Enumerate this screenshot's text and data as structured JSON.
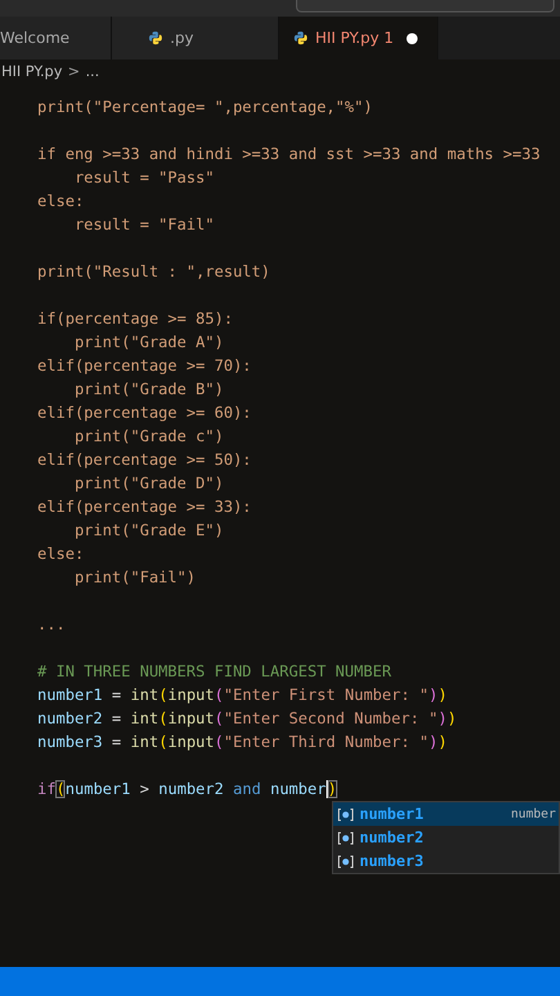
{
  "tabs": [
    {
      "label": "Welcome",
      "kind": "plain",
      "selected": false,
      "has_problems": false,
      "modified": false
    },
    {
      "label": ".py",
      "kind": "python",
      "selected": false,
      "has_problems": false,
      "modified": false
    },
    {
      "label": "HII PY.py 1",
      "kind": "python",
      "selected": true,
      "has_problems": true,
      "modified": true
    }
  ],
  "breadcrumb": {
    "file": "HII PY.py",
    "separator": ">",
    "tail": "..."
  },
  "editor": {
    "lines": [
      {
        "tokens": [
          {
            "text": "print(\"Percentage= \",percentage,\"%\")",
            "kind": "plain"
          }
        ]
      },
      {
        "kind": "blank"
      },
      {
        "tokens": [
          {
            "text": "if eng >=33 and hindi >=33 and sst >=33 and maths >=33",
            "kind": "plain"
          }
        ]
      },
      {
        "tokens": [
          {
            "text": "    result = \"Pass\"",
            "kind": "plain"
          }
        ]
      },
      {
        "tokens": [
          {
            "text": "else:",
            "kind": "plain"
          }
        ]
      },
      {
        "tokens": [
          {
            "text": "    result = \"Fail\"",
            "kind": "plain"
          }
        ]
      },
      {
        "kind": "blank"
      },
      {
        "tokens": [
          {
            "text": "print(\"Result : \",result)",
            "kind": "plain"
          }
        ]
      },
      {
        "kind": "blank"
      },
      {
        "tokens": [
          {
            "text": "if(percentage >= 85):",
            "kind": "plain"
          }
        ]
      },
      {
        "tokens": [
          {
            "text": "    print(\"Grade A\")",
            "kind": "plain"
          }
        ]
      },
      {
        "tokens": [
          {
            "text": "elif(percentage >= 70):",
            "kind": "plain"
          }
        ]
      },
      {
        "tokens": [
          {
            "text": "    print(\"Grade B\")",
            "kind": "plain"
          }
        ]
      },
      {
        "tokens": [
          {
            "text": "elif(percentage >= 60):",
            "kind": "plain"
          }
        ]
      },
      {
        "tokens": [
          {
            "text": "    print(\"Grade c\")",
            "kind": "plain"
          }
        ]
      },
      {
        "tokens": [
          {
            "text": "elif(percentage >= 50):",
            "kind": "plain"
          }
        ]
      },
      {
        "tokens": [
          {
            "text": "    print(\"Grade D\")",
            "kind": "plain"
          }
        ]
      },
      {
        "tokens": [
          {
            "text": "elif(percentage >= 33):",
            "kind": "plain"
          }
        ]
      },
      {
        "tokens": [
          {
            "text": "    print(\"Grade E\")",
            "kind": "plain"
          }
        ]
      },
      {
        "tokens": [
          {
            "text": "else:",
            "kind": "plain"
          }
        ]
      },
      {
        "tokens": [
          {
            "text": "    print(\"Fail\")",
            "kind": "plain"
          }
        ]
      },
      {
        "kind": "blank"
      },
      {
        "tokens": [
          {
            "text": "...",
            "kind": "plain"
          }
        ]
      },
      {
        "kind": "blank"
      },
      {
        "tokens": [
          {
            "text": "# IN THREE NUMBERS FIND LARGEST NUMBER",
            "kind": "comment"
          }
        ]
      },
      {
        "tokens": [
          {
            "text": "number1",
            "kind": "variable"
          },
          {
            "text": " = ",
            "kind": "operator"
          },
          {
            "text": "int",
            "kind": "function"
          },
          {
            "text": "(",
            "kind": "bracket"
          },
          {
            "text": "input",
            "kind": "function"
          },
          {
            "text": "(",
            "kind": "bracket2"
          },
          {
            "text": "\"Enter First Number: \"",
            "kind": "string"
          },
          {
            "text": ")",
            "kind": "bracket2"
          },
          {
            "text": ")",
            "kind": "bracket"
          }
        ]
      },
      {
        "tokens": [
          {
            "text": "number2",
            "kind": "variable"
          },
          {
            "text": " = ",
            "kind": "operator"
          },
          {
            "text": "int",
            "kind": "function"
          },
          {
            "text": "(",
            "kind": "bracket"
          },
          {
            "text": "input",
            "kind": "function"
          },
          {
            "text": "(",
            "kind": "bracket2"
          },
          {
            "text": "\"Enter Second Number: \"",
            "kind": "string"
          },
          {
            "text": ")",
            "kind": "bracket2"
          },
          {
            "text": ")",
            "kind": "bracket"
          }
        ]
      },
      {
        "tokens": [
          {
            "text": "number3",
            "kind": "variable"
          },
          {
            "text": " = ",
            "kind": "operator"
          },
          {
            "text": "int",
            "kind": "function"
          },
          {
            "text": "(",
            "kind": "bracket"
          },
          {
            "text": "input",
            "kind": "function"
          },
          {
            "text": "(",
            "kind": "bracket2"
          },
          {
            "text": "\"Enter Third Number: \"",
            "kind": "string"
          },
          {
            "text": ")",
            "kind": "bracket2"
          },
          {
            "text": ")",
            "kind": "bracket"
          }
        ]
      },
      {
        "kind": "blank"
      },
      {
        "tokens": [
          {
            "text": "if",
            "kind": "control"
          },
          {
            "text": "(",
            "kind": "bracket-match"
          },
          {
            "text": "number1",
            "kind": "variable"
          },
          {
            "text": " > ",
            "kind": "operator"
          },
          {
            "text": "number2",
            "kind": "variable"
          },
          {
            "text": " and ",
            "kind": "keyword"
          },
          {
            "text": "number",
            "kind": "variable"
          },
          {
            "text": ")",
            "kind": "bracket-match",
            "caret": true
          }
        ]
      }
    ]
  },
  "suggestions": [
    {
      "label": "number1",
      "detail": "number",
      "selected": true
    },
    {
      "label": "number2",
      "selected": false
    },
    {
      "label": "number3",
      "selected": false
    }
  ]
}
